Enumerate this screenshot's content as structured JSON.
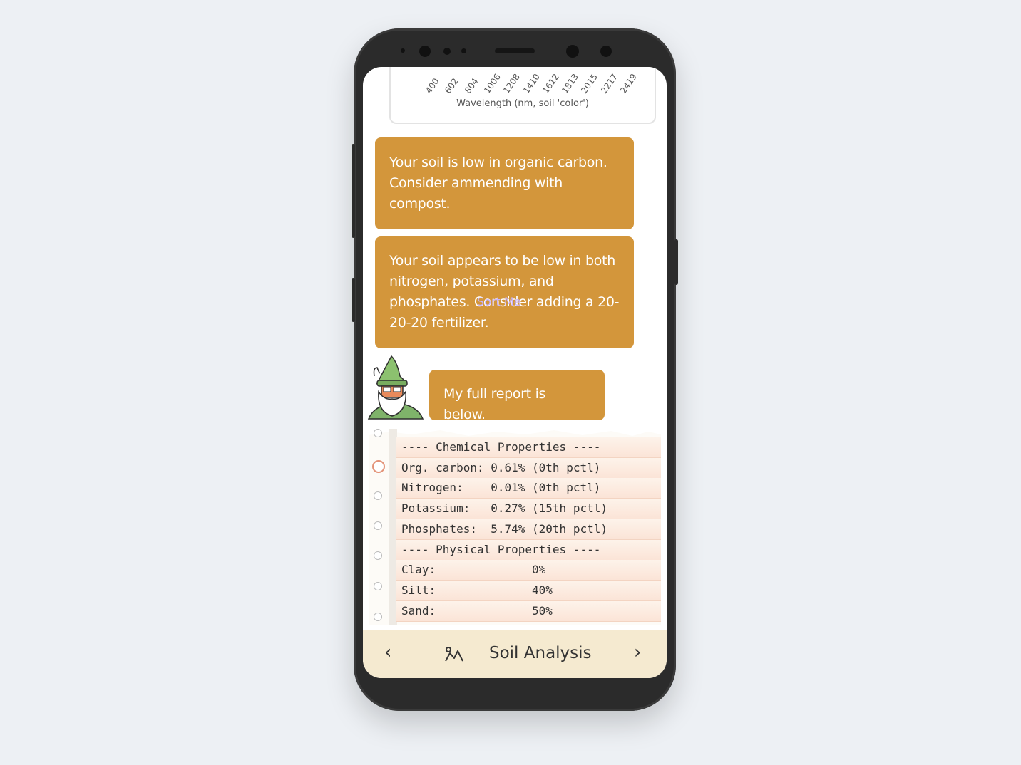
{
  "chart": {
    "x_ticks": [
      "400",
      "602",
      "804",
      "1006",
      "1208",
      "1410",
      "1612",
      "1813",
      "2015",
      "2217",
      "2419"
    ],
    "xlabel": "Wavelength (nm, soil 'color')"
  },
  "messages": [
    {
      "text": "Your soil is low in organic carbon. Consider ammending with compost."
    },
    {
      "text": "Your soil appears to be low in both nitrogen, potassium, and phosphates. Consider adding a 20-20-20 fertilizer."
    },
    {
      "text": "My full report is below."
    }
  ],
  "overlay_text": "Sort Me",
  "report": {
    "lines": [
      "---- Chemical Properties ----",
      "Org. carbon: 0.61% (0th pctl)",
      "Nitrogen:    0.01% (0th pctl)",
      "Potassium:   0.27% (15th pctl)",
      "Phosphates:  5.74% (20th pctl)",
      "---- Physical Properties ----",
      "Clay:              0%",
      "Silt:              40%",
      "Sand:              50%"
    ]
  },
  "bottom_nav": {
    "prev_icon": "chevron-left-icon",
    "title": "Soil Analysis",
    "icon": "soil-analysis-icon",
    "next_icon": "chevron-right-icon"
  },
  "colors": {
    "bubble": "#d3963b",
    "nav_bg": "#f5ead0",
    "background": "#edf0f4"
  }
}
